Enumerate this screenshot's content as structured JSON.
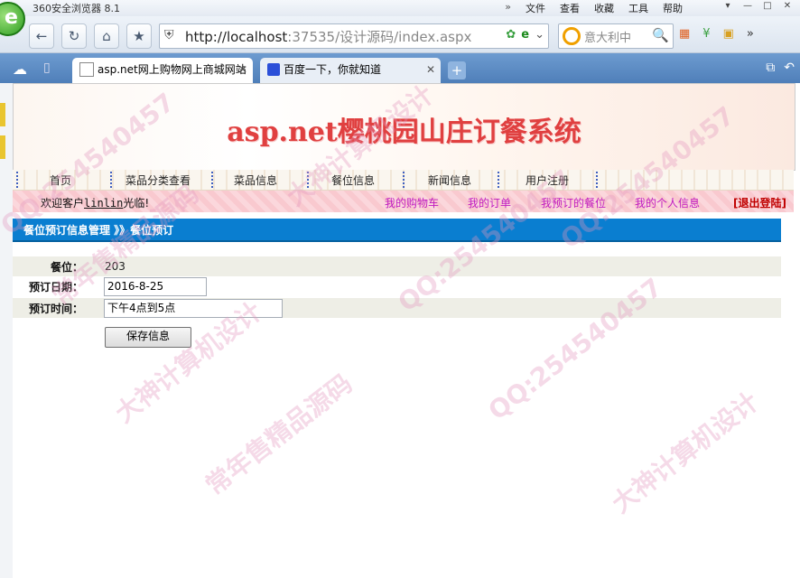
{
  "browser": {
    "app_title": "360安全浏览器 8.1",
    "menu": [
      "文件",
      "查看",
      "收藏",
      "工具",
      "帮助"
    ],
    "address_url_host": "http://localhost",
    "address_url_rest": ":37535/设计源码/index.aspx",
    "search_placeholder": "意大利中",
    "tabs": [
      {
        "label": "asp.net网上购物网上商城网站",
        "active": true
      },
      {
        "label": "百度一下，你就知道",
        "active": false
      }
    ]
  },
  "site": {
    "banner_title": "asp.net樱桃园山庄订餐系统",
    "nav": [
      "首页",
      "菜品分类查看",
      "菜品信息",
      "餐位信息",
      "新闻信息",
      "用户注册"
    ],
    "welcome_prefix": "欢迎客户",
    "welcome_user": "linlin",
    "welcome_suffix": "光临!",
    "links": [
      "我的购物车",
      "我的订单",
      "我预订的餐位",
      "我的个人信息"
    ],
    "logout": "[退出登陆]"
  },
  "section": {
    "breadcrumb": "餐位预订信息管理 》》餐位预订"
  },
  "form": {
    "seat_label": "餐位：",
    "seat_value": "203",
    "date_label": "预订日期：",
    "date_value": "2016-8-25",
    "time_label": "预订时间：",
    "time_value": "下午4点到5点",
    "save_label": "保存信息"
  },
  "watermarks": [
    "QQ:254540457",
    "常年售精品源码",
    "大神计算机设计",
    "QQ:254540457",
    "大神计算机设计",
    "常年售精品源码",
    "QQ:254540457",
    "大神计算机设计",
    "QQ:254540457"
  ]
}
